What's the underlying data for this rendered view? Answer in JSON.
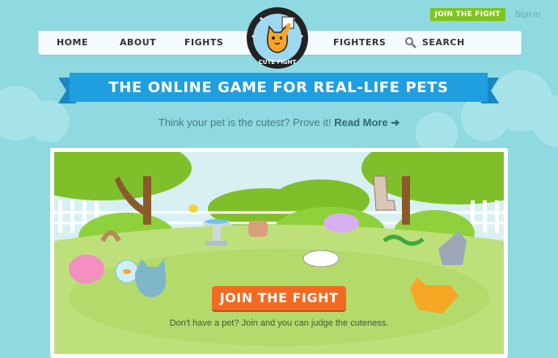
{
  "header": {
    "join_button": "JOIN THE FIGHT",
    "sign_in": "Sign In"
  },
  "nav": {
    "home": "HOME",
    "about": "ABOUT",
    "fights": "FIGHTS",
    "fighters": "FIGHTERS",
    "search": "SEARCH"
  },
  "logo": {
    "text": "CUTE FIGHT"
  },
  "hero": {
    "banner": "THE ONLINE GAME FOR REAL-LIFE PETS",
    "tagline": "Think your pet is the cutest? Prove it!",
    "read_more": "Read More ➔",
    "cta": "JOIN THE FIGHT",
    "cta_sub": "Don't have a pet? Join and you can judge the cuteness."
  },
  "colors": {
    "background": "#8fd9e0",
    "banner": "#1f9fe0",
    "join_green": "#7ec320",
    "cta_orange": "#f26a21",
    "grass": "#bde07a"
  }
}
